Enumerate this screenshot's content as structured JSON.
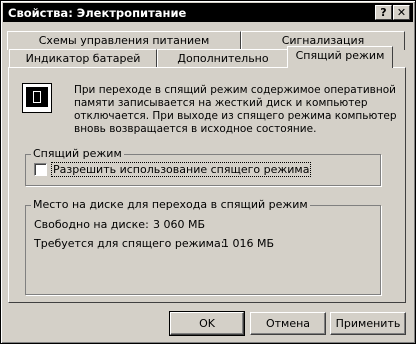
{
  "window": {
    "title": "Свойства: Электропитание"
  },
  "titlebar_buttons": {
    "help_glyph": "?",
    "close_glyph": "✕"
  },
  "tabs": {
    "power_schemes": "Схемы управления питанием",
    "alarms": "Сигнализация",
    "battery_meter": "Индикатор батарей",
    "advanced": "Дополнительно",
    "hibernate": "Спящий режим"
  },
  "info_text": {
    "line1": "При переходе в спящий режим содержимое оперативной",
    "line2": "памяти записывается на жесткий диск и компьютер",
    "line3": "отключается. При выходе из спящего режима компьютер",
    "line4": "вновь возвращается в исходное состояние."
  },
  "hibernate_group": {
    "title": "Спящий режим",
    "checkbox_label": "Разрешить использование спящего режима",
    "checked": false
  },
  "disk_group": {
    "title": "Место на диске для перехода в спящий режим",
    "free_label": "Свободно на диске:",
    "free_value": "3 060 МБ",
    "required_label": "Требуется для спящего режима:",
    "required_value": "1 016 МБ"
  },
  "buttons": {
    "ok": "OK",
    "cancel": "Отмена",
    "apply": "Применить"
  }
}
